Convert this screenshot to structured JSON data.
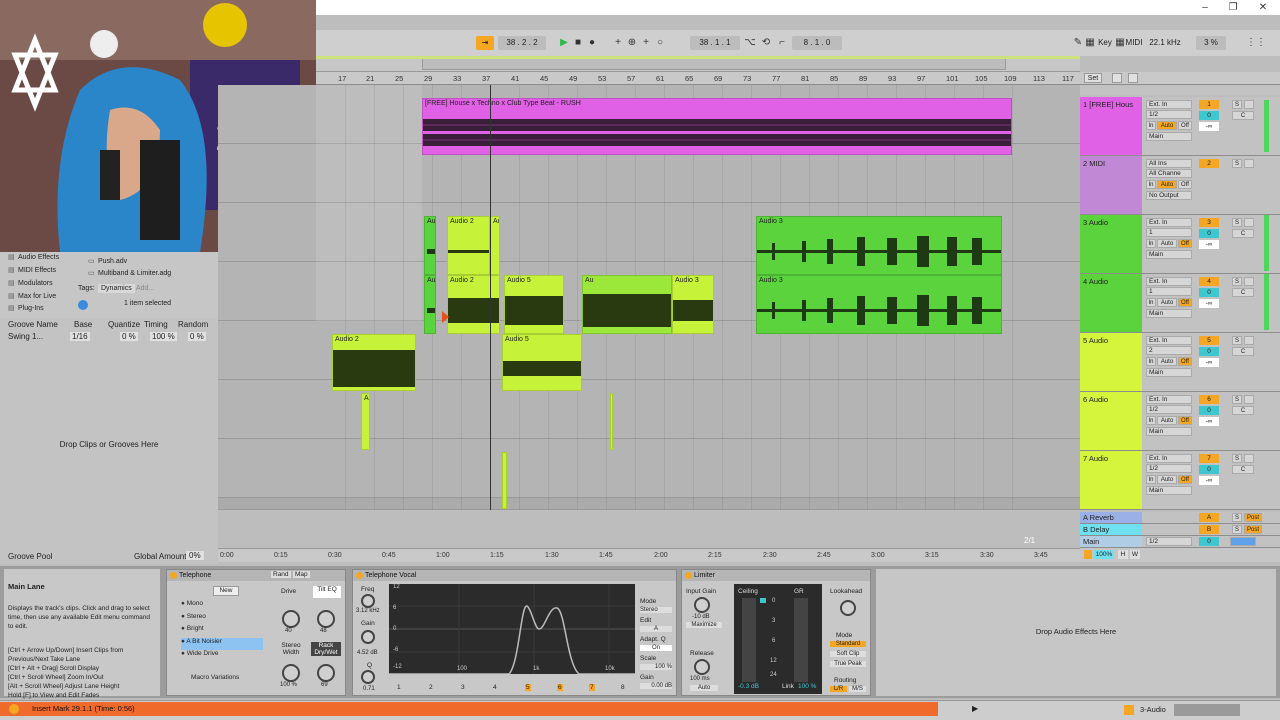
{
  "window": {
    "min": "–",
    "restore": "❐",
    "close": "✕"
  },
  "transport": {
    "bar_position": "38 .  2 .  2",
    "arrangement_pos": "38 .  1 .  1",
    "loop_length": "8 .  1 .  0",
    "key_label": "Key",
    "midi_label": "MIDI",
    "sample_rate": "22.1 kHz",
    "cpu": "3 %"
  },
  "ruler_bars": [
    "17",
    "21",
    "25",
    "29",
    "33",
    "37",
    "41",
    "45",
    "49",
    "53",
    "57",
    "61",
    "65",
    "69",
    "73",
    "77",
    "81",
    "85",
    "89",
    "93",
    "97",
    "101",
    "105",
    "109",
    "113",
    "117"
  ],
  "set_label": "Set",
  "time_ticks": [
    "0:00",
    "0:15",
    "0:30",
    "0:45",
    "1:00",
    "1:15",
    "1:30",
    "1:45",
    "2:00",
    "2:15",
    "2:30",
    "2:45",
    "3:00",
    "3:15",
    "3:30",
    "3:45"
  ],
  "page_indicator": "2/1",
  "clips": {
    "house": "[FREE] House x Techno x Club Type Beat - RUSH",
    "audio2": "Audio 2",
    "audio3": "Audio 3",
    "audio5": "Audio 5",
    "au": "Au"
  },
  "tracks": [
    {
      "name": "1 [FREE] Hous",
      "input": "Ext. In",
      "ch": "1/2",
      "out": "Main",
      "num": "1",
      "vol": "0",
      "pan": "C",
      "send": "-∞"
    },
    {
      "name": "2 MIDI",
      "input": "All Ins",
      "ch": "All Channe",
      "out": "No Output",
      "num": "2",
      "vol": "",
      "pan": "",
      "send": ""
    },
    {
      "name": "3 Audio",
      "input": "Ext. In",
      "ch": "1",
      "out": "Main",
      "num": "3",
      "vol": "0",
      "pan": "C",
      "send": "-∞"
    },
    {
      "name": "4 Audio",
      "input": "Ext. In",
      "ch": "1",
      "out": "Main",
      "num": "4",
      "vol": "0",
      "pan": "C",
      "send": "-∞"
    },
    {
      "name": "5 Audio",
      "input": "Ext. In",
      "ch": "2",
      "out": "Main",
      "num": "5",
      "vol": "0",
      "pan": "C",
      "send": "-∞"
    },
    {
      "name": "6 Audio",
      "input": "Ext. In",
      "ch": "1/2",
      "out": "Main",
      "num": "6",
      "vol": "0",
      "pan": "C",
      "send": "-∞"
    },
    {
      "name": "7 Audio",
      "input": "Ext. In",
      "ch": "1/2",
      "out": "Main",
      "num": "7",
      "vol": "0",
      "pan": "C",
      "send": "-∞"
    }
  ],
  "monitor": {
    "in": "In",
    "auto": "Auto",
    "off": "Off",
    "s": "S"
  },
  "returns": [
    {
      "name": "A Reverb",
      "letter": "A",
      "post": "Post"
    },
    {
      "name": "B Delay",
      "letter": "B",
      "post": "Post"
    },
    {
      "name": "Main",
      "letter": "0",
      "post": "1/2"
    }
  ],
  "master_extra": {
    "percent": "100%",
    "h": "H",
    "w": "W"
  },
  "browser": {
    "items": [
      "Audio Effects",
      "MIDI Effects",
      "Modulators",
      "Max for Live",
      "Plug-Ins"
    ],
    "files": [
      "Push.adv",
      "Multiband & Limiter.adg"
    ],
    "tags_label": "Tags:",
    "tag": "Dynamics",
    "tag_add": "Add...",
    "selected": "1 item selected"
  },
  "groove": {
    "headers": [
      "Groove Name",
      "Base",
      "Quantize",
      "Timing",
      "Random"
    ],
    "row": [
      "Swing 1...",
      "1/16",
      "0 %",
      "100 %",
      "0 %"
    ],
    "drop": "Drop Clips or Grooves Here",
    "pool": "Groove Pool",
    "global": "Global Amount",
    "global_val": "0%"
  },
  "info": {
    "title": "Main Lane",
    "body": "Displays the track's clips. Click and drag to select time, then use any available Edit menu command to edit.",
    "shortcuts": "[Ctrl + Arrow Up/Down] Insert Clips from Previous/Next Take Lane\n[Ctrl + Alt + Drag] Scroll Display\n[Ctrl + Scroll Wheel] Zoom In/Out\n[Alt + Scroll Wheel] Adjust Lane Height\nHold [F] to View and Edit Fades"
  },
  "telephone": {
    "title": "Telephone",
    "new": "New",
    "rand": "Rand",
    "map": "Map",
    "macros": [
      "Mono",
      "Stereo",
      "Bright",
      "A Bit Noisier",
      "Wide Drive"
    ],
    "variations": "Macro Variations",
    "drive": "Drive",
    "tilt": "Tilt EQ",
    "tilt_val": "48",
    "drive_val": "40",
    "stereo": "Stereo Width",
    "stereo_val": "100 %",
    "rack": "Rack Dry/Wet",
    "rack_val": "69"
  },
  "vocal": {
    "title": "Telephone Vocal",
    "freq": "Freq",
    "freq_val": "3.12 kHz",
    "gain": "Gain",
    "gain_val": "4.52 dB",
    "q": "Q",
    "q_val": "0.71",
    "db_ticks": [
      "12",
      "6",
      "0",
      "-6",
      "-12"
    ],
    "hz_ticks": [
      "100",
      "1k",
      "10k"
    ],
    "mode": "Mode",
    "mode_val": "Stereo",
    "edit": "Edit",
    "edit_val": "A",
    "adapt": "Adapt. Q",
    "adapt_val": "On",
    "scale": "Scale",
    "scale_val": "100 %",
    "gain2": "Gain",
    "gain2_val": "0.00 dB",
    "bands": [
      "1",
      "2",
      "3",
      "4",
      "5",
      "6",
      "7",
      "8"
    ]
  },
  "limiter": {
    "title": "Limiter",
    "input": "Input Gain",
    "input_val": "-10 dB",
    "maximize": "Maximize",
    "release": "Release",
    "release_val": "100 ms",
    "auto": "Auto",
    "ceiling": "Ceiling",
    "gr": "GR",
    "ceiling_val": "-0.3 dB",
    "link": "Link",
    "link_val": "100 %",
    "scale": [
      "0",
      "3",
      "6",
      "12",
      "24"
    ],
    "lookahead": "Lookahead",
    "mode": "Mode",
    "modes": [
      "Standard",
      "Soft Clip",
      "True Peak"
    ],
    "routing": "Routing",
    "lr": "L/R",
    "ms": "M/S"
  },
  "drop_fx": "Drop Audio Effects Here",
  "status": {
    "message": "Insert Mark 29.1.1 (Time: 0:56)",
    "track": "3-Audio"
  }
}
